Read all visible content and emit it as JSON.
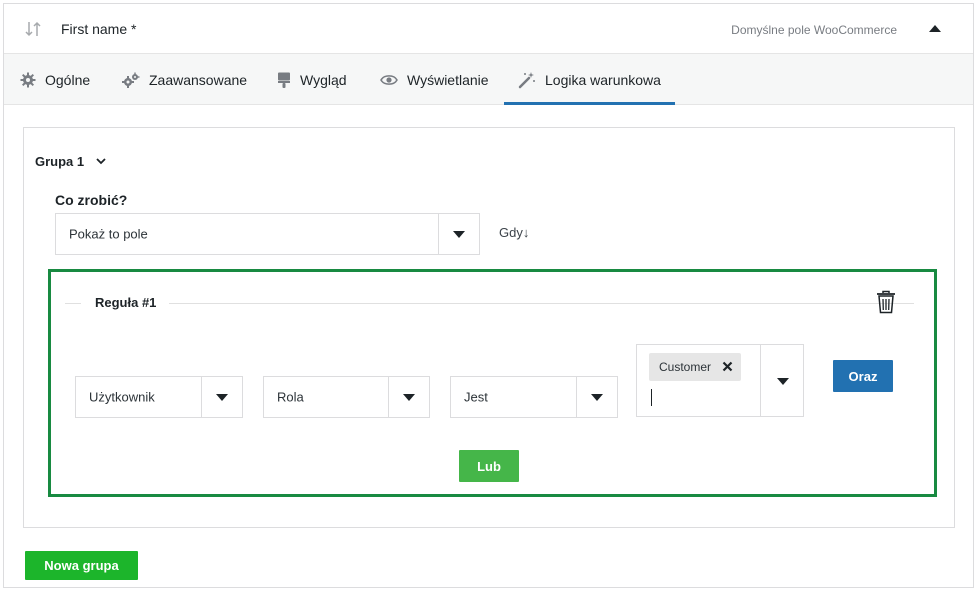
{
  "field": {
    "title": "First name *",
    "source": "Domyślne pole WooCommerce"
  },
  "tabs": [
    {
      "label": "Ogólne",
      "icon": "gear-icon"
    },
    {
      "label": "Zaawansowane",
      "icon": "gears-icon"
    },
    {
      "label": "Wygląd",
      "icon": "brush-icon"
    },
    {
      "label": "Wyświetlanie",
      "icon": "eye-icon"
    },
    {
      "label": "Logika warunkowa",
      "icon": "magic-wand-icon",
      "active": true
    }
  ],
  "group": {
    "title": "Grupa 1",
    "action_label": "Co zrobić?",
    "action_value": "Pokaż to pole",
    "when_label": "Gdy↓",
    "rule": {
      "title": "Reguła #1",
      "condition_type": "Użytkownik",
      "condition_field": "Rola",
      "operator": "Jest",
      "values": [
        "Customer"
      ]
    },
    "and_button": "Oraz",
    "or_button": "Lub"
  },
  "new_group_button": "Nowa grupa",
  "colors": {
    "active_tab": "#2271b1",
    "rule_border": "#188a41",
    "and_button": "#2271b1",
    "or_button": "#45b649",
    "new_group_button": "#1cb52b"
  }
}
